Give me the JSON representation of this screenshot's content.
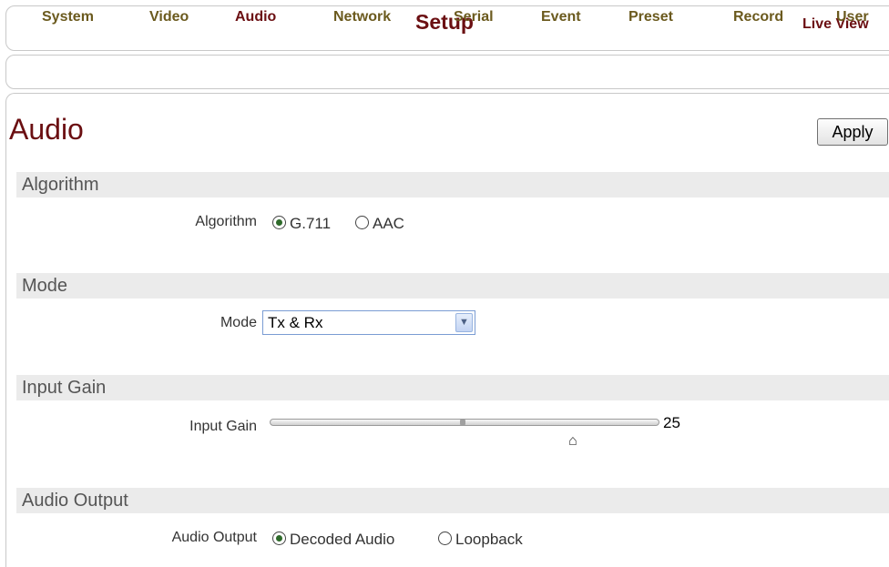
{
  "header": {
    "title": "Setup",
    "live_view": "Live View"
  },
  "nav": {
    "items": [
      {
        "label": "System"
      },
      {
        "label": "Video"
      },
      {
        "label": "Audio"
      },
      {
        "label": "Network"
      },
      {
        "label": "Serial"
      },
      {
        "label": "Event"
      },
      {
        "label": "Preset"
      },
      {
        "label": "Record"
      },
      {
        "label": "User"
      }
    ],
    "active": "Audio"
  },
  "page": {
    "title": "Audio",
    "apply_label": "Apply"
  },
  "sections": {
    "algorithm": {
      "heading": "Algorithm",
      "label": "Algorithm",
      "options": [
        "G.711",
        "AAC"
      ],
      "selected": "G.711"
    },
    "mode": {
      "heading": "Mode",
      "label": "Mode",
      "value": "Tx & Rx"
    },
    "input_gain": {
      "heading": "Input Gain",
      "label": "Input Gain",
      "value": "25"
    },
    "audio_output": {
      "heading": "Audio Output",
      "label": "Audio Output",
      "options": [
        "Decoded Audio",
        "Loopback"
      ],
      "selected": "Decoded Audio"
    }
  },
  "icons": {
    "select_arrow": "chevron-down-icon",
    "slider_thumb": "slider-thumb-icon"
  },
  "colors": {
    "title": "#6b0f12",
    "nav": "#6b5a1e",
    "section_bg": "#ebebeb"
  }
}
